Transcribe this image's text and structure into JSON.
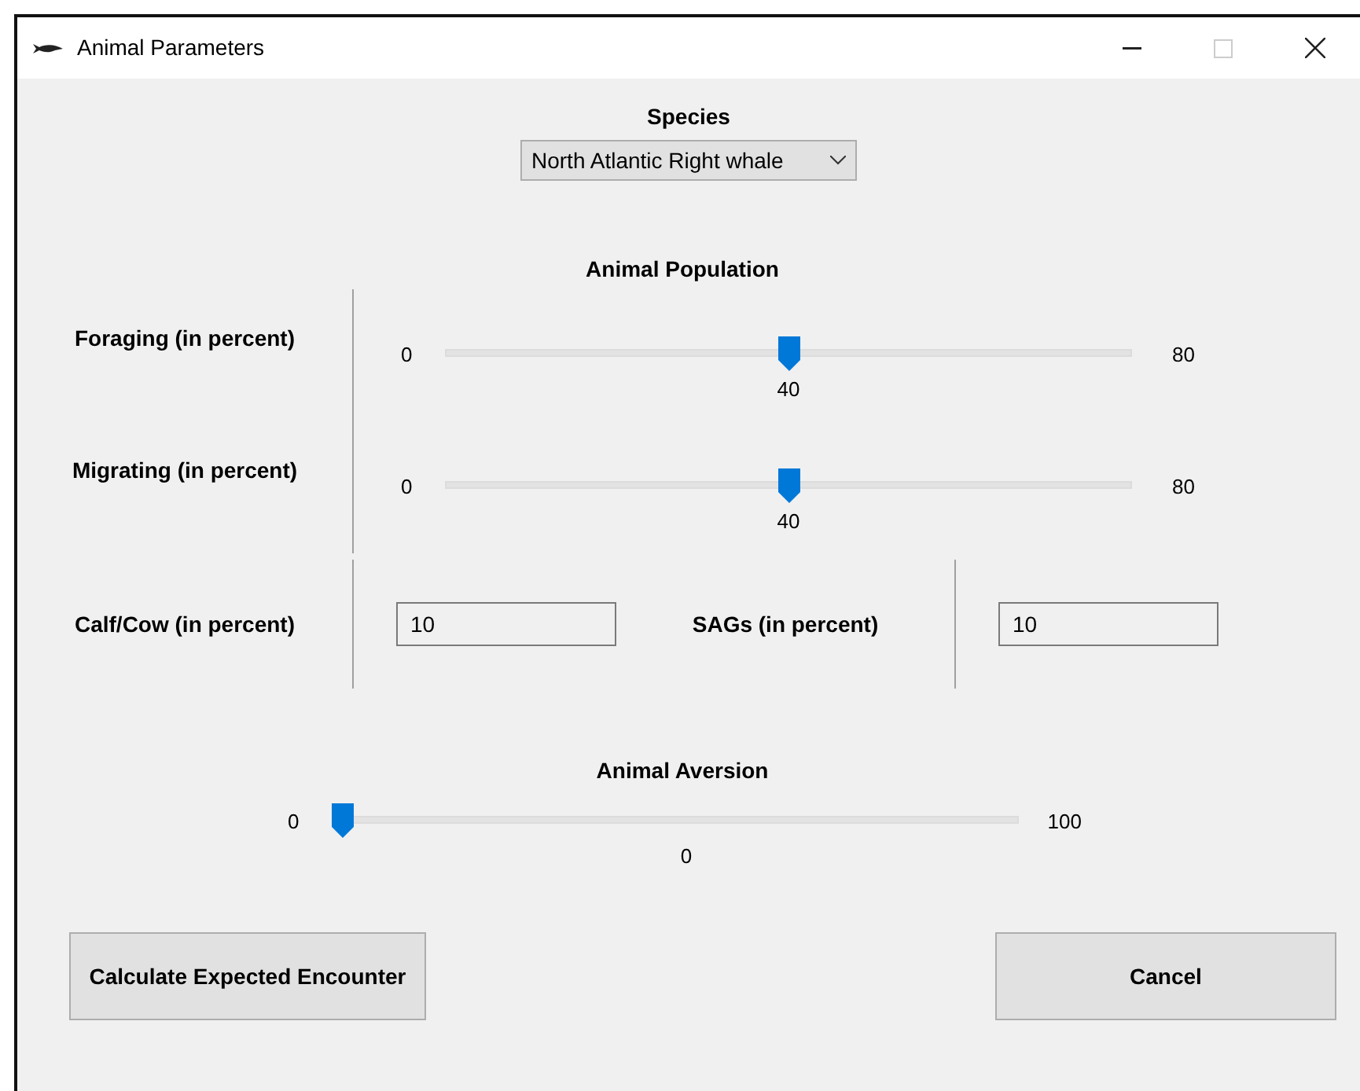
{
  "window": {
    "title": "Animal Parameters"
  },
  "species": {
    "label": "Species",
    "value": "North Atlantic Right whale"
  },
  "population": {
    "heading": "Animal Population",
    "sliders": [
      {
        "label": "Foraging (in percent)",
        "min": "0",
        "max": "80",
        "reading": "40",
        "level": 0.5
      },
      {
        "label": "Migrating (in percent)",
        "min": "0",
        "max": "80",
        "reading": "40",
        "level": 0.5
      }
    ],
    "fields": [
      {
        "label": "Calf/Cow (in percent)",
        "value": "10"
      },
      {
        "label": "SAGs (in percent)",
        "value": "10"
      }
    ]
  },
  "aversion": {
    "heading": "Animal Aversion",
    "min": "0",
    "max": "100",
    "reading": "0",
    "level": 0
  },
  "buttons": [
    "Calculate Expected Encounter",
    "Cancel"
  ]
}
